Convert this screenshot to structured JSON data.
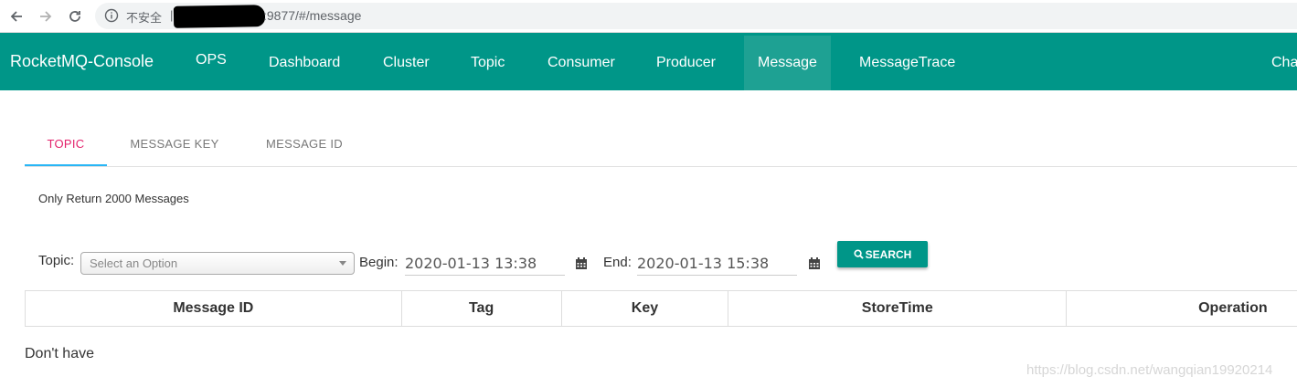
{
  "browser": {
    "security_label": "不安全",
    "separator": "|",
    "url_visible": ":9877/#/message"
  },
  "app": {
    "brand": "RocketMQ-Console",
    "nav": [
      "OPS",
      "Dashboard",
      "Cluster",
      "Topic",
      "Consumer",
      "Producer",
      "Message",
      "MessageTrace",
      "Cha"
    ],
    "active_nav": "Message",
    "accent_color": "#009688"
  },
  "tabs": {
    "items": [
      "TOPIC",
      "MESSAGE KEY",
      "MESSAGE ID"
    ],
    "active": "TOPIC"
  },
  "note": "Only Return 2000 Messages",
  "search": {
    "topic_label": "Topic:",
    "topic_placeholder": "Select an Option",
    "begin_label": "Begin:",
    "begin_value": "2020-01-13 13:38",
    "end_label": "End:",
    "end_value": "2020-01-13 15:38",
    "search_label": "SEARCH"
  },
  "table": {
    "columns": [
      "Message ID",
      "Tag",
      "Key",
      "StoreTime",
      "Operation"
    ],
    "empty_text": "Don't have"
  },
  "watermark": "https://blog.csdn.net/wangqian19920214"
}
